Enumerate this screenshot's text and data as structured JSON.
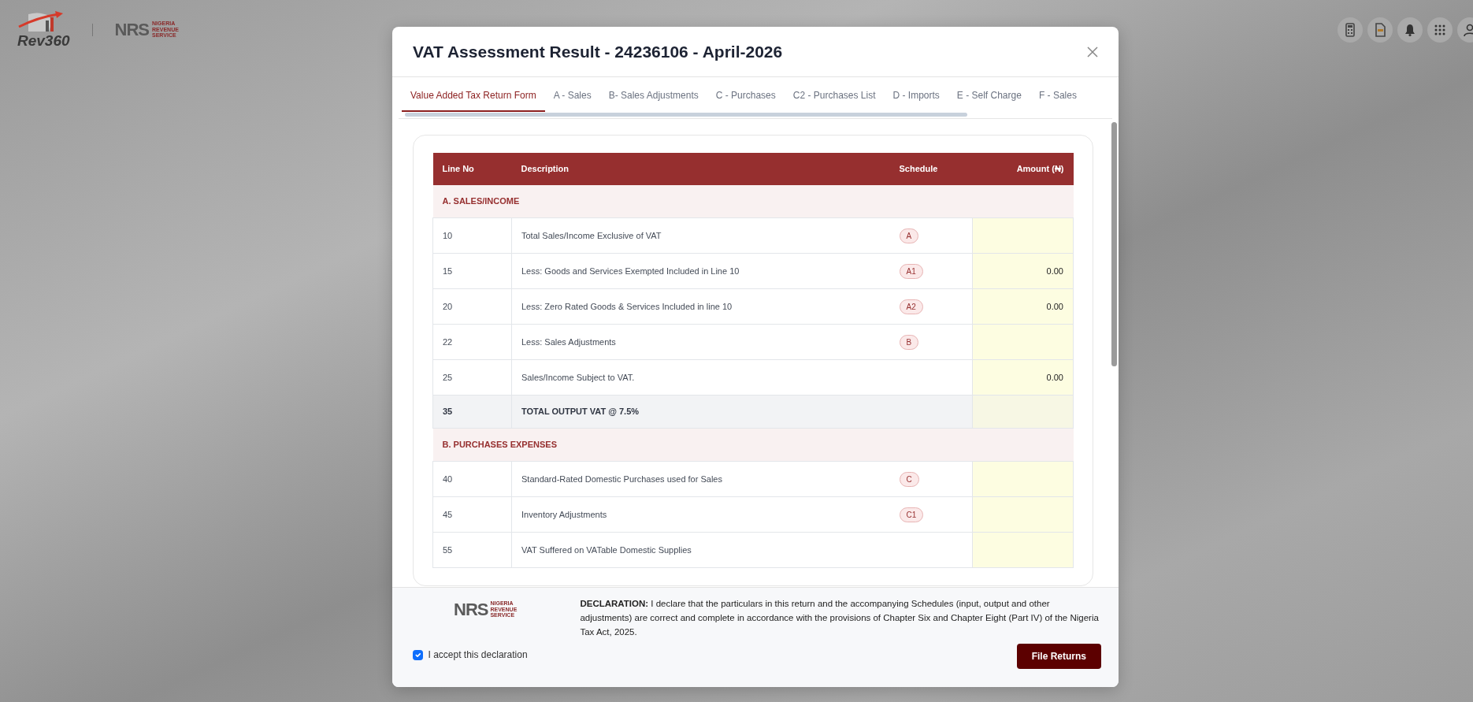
{
  "brand": {
    "logo_text": "Rev360",
    "agency_short": "NRS",
    "agency_name": "NIGERIA REVENUE SERVICE"
  },
  "top_icons": [
    {
      "kind": "calculator"
    },
    {
      "kind": "document"
    },
    {
      "kind": "bell"
    },
    {
      "kind": "grid"
    },
    {
      "kind": "user"
    }
  ],
  "modal": {
    "title": "VAT Assessment Result - 24236106 - April-2026",
    "tabs": [
      {
        "label": "Value Added Tax Return Form",
        "selected": true
      },
      {
        "label": "A - Sales",
        "selected": false
      },
      {
        "label": "B- Sales Adjustments",
        "selected": false
      },
      {
        "label": "C - Purchases",
        "selected": false
      },
      {
        "label": "C2 - Purchases List",
        "selected": false
      },
      {
        "label": "D - Imports",
        "selected": false
      },
      {
        "label": "E - Self Charge",
        "selected": false
      },
      {
        "label": "F - Sales",
        "selected": false
      }
    ],
    "table": {
      "columns": [
        "Line No",
        "Description",
        "Schedule",
        "Amount (₦)"
      ],
      "sections": [
        {
          "title": "A. SALES/INCOME",
          "rows": [
            {
              "kind": "line",
              "line_no": "10",
              "description": "Total Sales/Income Exclusive of VAT",
              "schedule": "A"
            },
            {
              "kind": "line",
              "line_no": "15",
              "description": "Less: Goods and Services Exempted Included in Line 10",
              "schedule": "A1",
              "amount": "0.00"
            },
            {
              "kind": "line",
              "line_no": "20",
              "description": "Less: Zero Rated Goods & Services Included in line 10",
              "schedule": "A2",
              "amount": "0.00"
            },
            {
              "kind": "line",
              "line_no": "22",
              "description": "Less: Sales Adjustments",
              "schedule": "B"
            },
            {
              "kind": "line",
              "line_no": "25",
              "description": "Sales/Income Subject to VAT.",
              "amount": "0.00"
            },
            {
              "kind": "total",
              "line_no": "35",
              "description": "TOTAL OUTPUT VAT @ 7.5%"
            }
          ]
        },
        {
          "title": "B. PURCHASES EXPENSES",
          "rows": [
            {
              "kind": "line",
              "line_no": "40",
              "description": "Standard-Rated Domestic Purchases used for Sales",
              "schedule": "C"
            },
            {
              "kind": "line",
              "line_no": "45",
              "description": "Inventory Adjustments",
              "schedule": "C1"
            },
            {
              "kind": "line",
              "line_no": "55",
              "description": "VAT Suffered on VATable Domestic Supplies"
            }
          ]
        }
      ]
    },
    "footer": {
      "logo_short": "NRS",
      "logo_name": "NIGERIA REVENUE SERVICE",
      "declaration": "**DECLARATION:** I declare that the particulars in this return and the accompanying Schedules (input, output and other adjustments) are correct and complete in accordance with the provisions of Chapter Six and Chapter Eight (Part IV) of the Nigeria Tax Act, 2025.",
      "accept": {
        "label": "I accept this declaration",
        "checked": true
      },
      "submit": "File Returns"
    }
  }
}
